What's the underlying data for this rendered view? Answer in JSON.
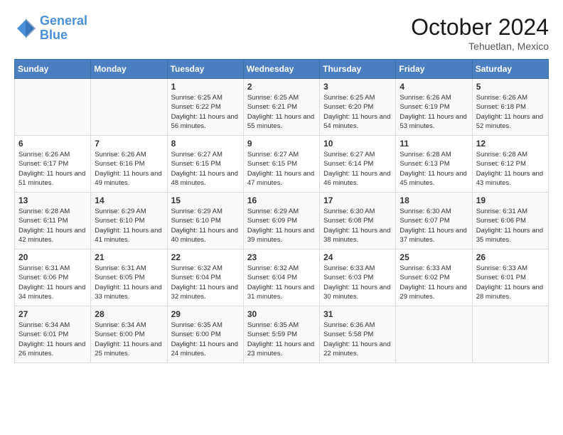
{
  "header": {
    "logo_line1": "General",
    "logo_line2": "Blue",
    "month": "October 2024",
    "location": "Tehuetlan, Mexico"
  },
  "days_of_week": [
    "Sunday",
    "Monday",
    "Tuesday",
    "Wednesday",
    "Thursday",
    "Friday",
    "Saturday"
  ],
  "weeks": [
    [
      {
        "day": "",
        "content": ""
      },
      {
        "day": "",
        "content": ""
      },
      {
        "day": "1",
        "content": "Sunrise: 6:25 AM\nSunset: 6:22 PM\nDaylight: 11 hours and 56 minutes."
      },
      {
        "day": "2",
        "content": "Sunrise: 6:25 AM\nSunset: 6:21 PM\nDaylight: 11 hours and 55 minutes."
      },
      {
        "day": "3",
        "content": "Sunrise: 6:25 AM\nSunset: 6:20 PM\nDaylight: 11 hours and 54 minutes."
      },
      {
        "day": "4",
        "content": "Sunrise: 6:26 AM\nSunset: 6:19 PM\nDaylight: 11 hours and 53 minutes."
      },
      {
        "day": "5",
        "content": "Sunrise: 6:26 AM\nSunset: 6:18 PM\nDaylight: 11 hours and 52 minutes."
      }
    ],
    [
      {
        "day": "6",
        "content": "Sunrise: 6:26 AM\nSunset: 6:17 PM\nDaylight: 11 hours and 51 minutes."
      },
      {
        "day": "7",
        "content": "Sunrise: 6:26 AM\nSunset: 6:16 PM\nDaylight: 11 hours and 49 minutes."
      },
      {
        "day": "8",
        "content": "Sunrise: 6:27 AM\nSunset: 6:15 PM\nDaylight: 11 hours and 48 minutes."
      },
      {
        "day": "9",
        "content": "Sunrise: 6:27 AM\nSunset: 6:15 PM\nDaylight: 11 hours and 47 minutes."
      },
      {
        "day": "10",
        "content": "Sunrise: 6:27 AM\nSunset: 6:14 PM\nDaylight: 11 hours and 46 minutes."
      },
      {
        "day": "11",
        "content": "Sunrise: 6:28 AM\nSunset: 6:13 PM\nDaylight: 11 hours and 45 minutes."
      },
      {
        "day": "12",
        "content": "Sunrise: 6:28 AM\nSunset: 6:12 PM\nDaylight: 11 hours and 43 minutes."
      }
    ],
    [
      {
        "day": "13",
        "content": "Sunrise: 6:28 AM\nSunset: 6:11 PM\nDaylight: 11 hours and 42 minutes."
      },
      {
        "day": "14",
        "content": "Sunrise: 6:29 AM\nSunset: 6:10 PM\nDaylight: 11 hours and 41 minutes."
      },
      {
        "day": "15",
        "content": "Sunrise: 6:29 AM\nSunset: 6:10 PM\nDaylight: 11 hours and 40 minutes."
      },
      {
        "day": "16",
        "content": "Sunrise: 6:29 AM\nSunset: 6:09 PM\nDaylight: 11 hours and 39 minutes."
      },
      {
        "day": "17",
        "content": "Sunrise: 6:30 AM\nSunset: 6:08 PM\nDaylight: 11 hours and 38 minutes."
      },
      {
        "day": "18",
        "content": "Sunrise: 6:30 AM\nSunset: 6:07 PM\nDaylight: 11 hours and 37 minutes."
      },
      {
        "day": "19",
        "content": "Sunrise: 6:31 AM\nSunset: 6:06 PM\nDaylight: 11 hours and 35 minutes."
      }
    ],
    [
      {
        "day": "20",
        "content": "Sunrise: 6:31 AM\nSunset: 6:06 PM\nDaylight: 11 hours and 34 minutes."
      },
      {
        "day": "21",
        "content": "Sunrise: 6:31 AM\nSunset: 6:05 PM\nDaylight: 11 hours and 33 minutes."
      },
      {
        "day": "22",
        "content": "Sunrise: 6:32 AM\nSunset: 6:04 PM\nDaylight: 11 hours and 32 minutes."
      },
      {
        "day": "23",
        "content": "Sunrise: 6:32 AM\nSunset: 6:04 PM\nDaylight: 11 hours and 31 minutes."
      },
      {
        "day": "24",
        "content": "Sunrise: 6:33 AM\nSunset: 6:03 PM\nDaylight: 11 hours and 30 minutes."
      },
      {
        "day": "25",
        "content": "Sunrise: 6:33 AM\nSunset: 6:02 PM\nDaylight: 11 hours and 29 minutes."
      },
      {
        "day": "26",
        "content": "Sunrise: 6:33 AM\nSunset: 6:01 PM\nDaylight: 11 hours and 28 minutes."
      }
    ],
    [
      {
        "day": "27",
        "content": "Sunrise: 6:34 AM\nSunset: 6:01 PM\nDaylight: 11 hours and 26 minutes."
      },
      {
        "day": "28",
        "content": "Sunrise: 6:34 AM\nSunset: 6:00 PM\nDaylight: 11 hours and 25 minutes."
      },
      {
        "day": "29",
        "content": "Sunrise: 6:35 AM\nSunset: 6:00 PM\nDaylight: 11 hours and 24 minutes."
      },
      {
        "day": "30",
        "content": "Sunrise: 6:35 AM\nSunset: 5:59 PM\nDaylight: 11 hours and 23 minutes."
      },
      {
        "day": "31",
        "content": "Sunrise: 6:36 AM\nSunset: 5:58 PM\nDaylight: 11 hours and 22 minutes."
      },
      {
        "day": "",
        "content": ""
      },
      {
        "day": "",
        "content": ""
      }
    ]
  ]
}
